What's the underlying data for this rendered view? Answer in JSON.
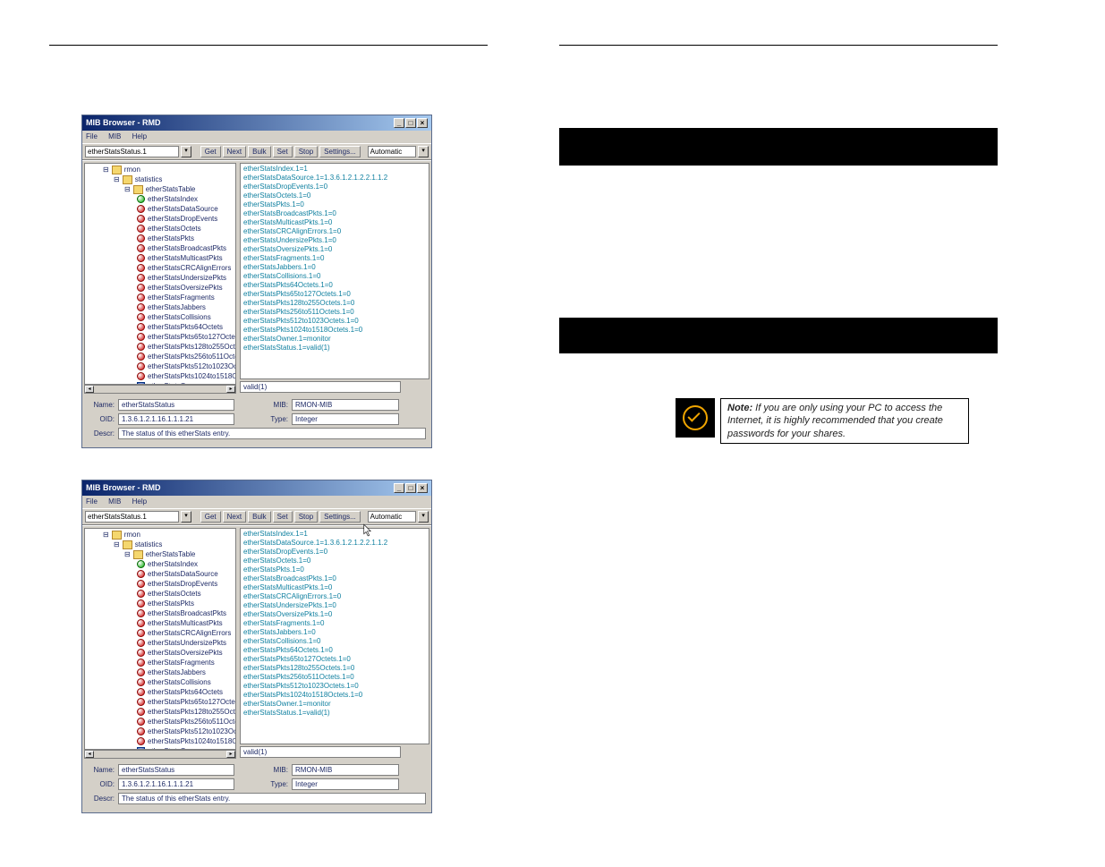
{
  "screenshot": {
    "title": "MIB Browser - RMD",
    "menu": {
      "file": "File",
      "mib": "MIB",
      "help": "Help"
    },
    "toolbarInput": "etherStatsStatus.1",
    "toolbarButtons": {
      "get": "Get",
      "next": "Next",
      "bulk": "Bulk",
      "set": "Set",
      "stop": "Stop",
      "settings": "Settings...",
      "auto": "Automatic"
    },
    "tree": {
      "root": "rmon",
      "stats": "statistics",
      "table": "etherStatsTable",
      "entry": "etherStatsIndex",
      "leaves": [
        "etherStatsDataSource",
        "etherStatsDropEvents",
        "etherStatsOctets",
        "etherStatsPkts",
        "etherStatsBroadcastPkts",
        "etherStatsMulticastPkts",
        "etherStatsCRCAlignErrors",
        "etherStatsUndersizePkts",
        "etherStatsOversizePkts",
        "etherStatsFragments",
        "etherStatsJabbers",
        "etherStatsCollisions",
        "etherStatsPkts64Octets",
        "etherStatsPkts65to127Octet",
        "etherStatsPkts128to255Octe",
        "etherStatsPkts256to511Octe",
        "etherStatsPkts512to1023Oct",
        "etherStatsPkts1024to1518O",
        "etherStatsOwner"
      ]
    },
    "results": [
      "etherStatsIndex.1=1",
      "etherStatsDataSource.1=1.3.6.1.2.1.2.2.1.1.2",
      "etherStatsDropEvents.1=0",
      "etherStatsOctets.1=0",
      "etherStatsPkts.1=0",
      "etherStatsBroadcastPkts.1=0",
      "etherStatsMulticastPkts.1=0",
      "etherStatsCRCAlignErrors.1=0",
      "etherStatsUndersizePkts.1=0",
      "etherStatsOversizePkts.1=0",
      "etherStatsFragments.1=0",
      "etherStatsJabbers.1=0",
      "etherStatsCollisions.1=0",
      "etherStatsPkts64Octets.1=0",
      "etherStatsPkts65to127Octets.1=0",
      "etherStatsPkts128to255Octets.1=0",
      "etherStatsPkts256to511Octets.1=0",
      "etherStatsPkts512to1023Octets.1=0",
      "etherStatsPkts1024to1518Octets.1=0",
      "etherStatsOwner.1=monitor",
      "etherStatsStatus.1=valid(1)"
    ],
    "resultFooter": "valid(1)",
    "form": {
      "nameLabel": "Name:",
      "name": "etherStatsStatus",
      "oidLabel": "OID:",
      "oid": "1.3.6.1.2.1.16.1.1.1.21",
      "mibLabel": "MIB:",
      "mib": "RMON-MIB",
      "typeLabel": "Type:",
      "type": "Integer",
      "descLabel": "Descr:",
      "desc": "The status of this etherStats entry."
    }
  },
  "note": {
    "label": "Note:",
    "text": "If you are only using your PC to access the Internet, it is highly recommended that you create passwords for your shares."
  }
}
